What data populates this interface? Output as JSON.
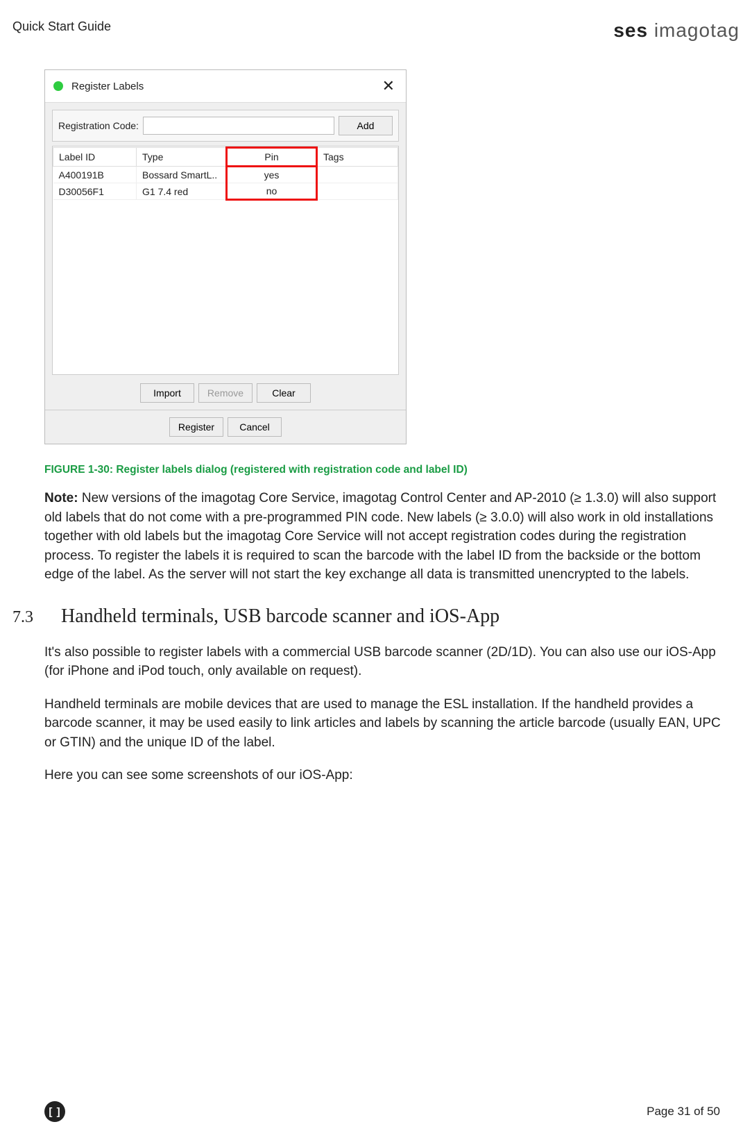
{
  "header": {
    "title": "Quick Start Guide",
    "logo_bold": "ses",
    "logo_light": "imagotag"
  },
  "dialog": {
    "title": "Register Labels",
    "close": "✕",
    "reg_label": "Registration Code:",
    "reg_value": "",
    "add_btn": "Add",
    "columns": {
      "id": "Label ID",
      "type": "Type",
      "pin": "Pin",
      "tags": "Tags"
    },
    "rows": [
      {
        "id": "A400191B",
        "type": "Bossard SmartL..",
        "pin": "yes",
        "tags": ""
      },
      {
        "id": "D30056F1",
        "type": "G1 7.4 red",
        "pin": "no",
        "tags": ""
      }
    ],
    "buttons": {
      "import": "Import",
      "remove": "Remove",
      "clear": "Clear",
      "register": "Register",
      "cancel": "Cancel"
    }
  },
  "figure_caption": "FIGURE 1-30: Register labels dialog (registered with registration code and label ID)",
  "note_label": "Note:",
  "note_text": " New versions of the imagotag Core Service, imagotag Control Center and AP-2010 (≥ 1.3.0) will also support old labels that do not come with a pre-programmed PIN code. New labels (≥ 3.0.0) will also work in old installations together with old labels but the imagotag Core Service will not accept registration codes during the registration process. To register the labels it is required to scan the barcode with the label ID from the backside or the bottom edge of the label. As the server will not start the key exchange all data is transmitted unencrypted to the labels.",
  "section": {
    "num": "7.3",
    "title": "Handheld terminals, USB barcode scanner and iOS-App",
    "p1": "It's also possible to register labels with a commercial USB barcode scanner (2D/1D). You can also use our iOS-App (for iPhone and iPod touch, only available on request).",
    "p2": "Handheld terminals are mobile devices that are used to manage the ESL installation. If the handheld provides a barcode scanner, it may be used easily to link articles and labels by scanning the article barcode (usually EAN, UPC or GTIN) and the unique ID of the label.",
    "p3": "Here you can see some screenshots of our iOS-App:"
  },
  "footer": {
    "icon": "[ ]",
    "page": "Page 31 of 50"
  }
}
